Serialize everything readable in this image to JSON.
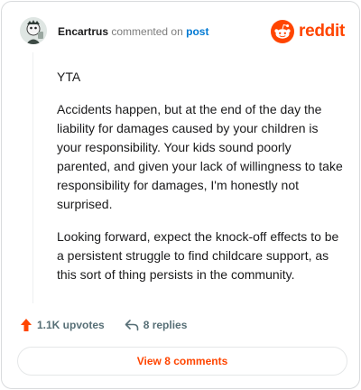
{
  "header": {
    "username": "Encartrus",
    "action_text": "commented on",
    "target_link": "post",
    "brand_name": "reddit",
    "brand_color": "#ff4500",
    "link_color": "#0079d3",
    "avatar_icon": "user-avatar-icon",
    "logo_icon": "reddit-snoo-icon"
  },
  "comment": {
    "paragraphs": [
      "YTA",
      "Accidents happen, but at the end of the day the liability for damages caused by your children is your responsibility. Your kids sound poorly parented, and given your lack of willingness to take responsibility for damages, I'm honestly not surprised.",
      "Looking forward, expect the knock-off effects to be a persistent struggle to find childcare support, as this sort of thing persists in the community."
    ]
  },
  "actions": {
    "upvotes_label": "1.1K upvotes",
    "replies_label": "8 replies",
    "upvote_icon": "upvote-arrow-icon",
    "reply_icon": "reply-arrow-icon",
    "upvote_color": "#ff4500"
  },
  "footer": {
    "view_comments_label": "View 8 comments"
  }
}
